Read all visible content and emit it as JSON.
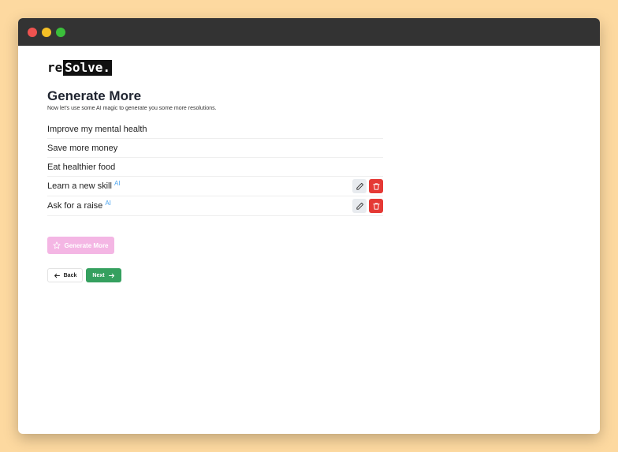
{
  "window": {
    "controls": [
      "close",
      "minimize",
      "maximize"
    ]
  },
  "logo": {
    "prefix": "re",
    "main": "Solve."
  },
  "page": {
    "title": "Generate More",
    "subtitle": "Now let's use some AI magic to generate you some more resolutions."
  },
  "resolutions": [
    {
      "text": "Improve my mental health",
      "ai": false
    },
    {
      "text": "Save more money",
      "ai": false
    },
    {
      "text": "Eat healthier food",
      "ai": false
    },
    {
      "text": "Learn a new skill",
      "ai": true,
      "ai_label": "AI"
    },
    {
      "text": "Ask for a raise",
      "ai": true,
      "ai_label": "AI"
    }
  ],
  "actions": {
    "generate_label": "Generate More"
  },
  "nav": {
    "back_label": "Back",
    "next_label": "Next"
  },
  "colors": {
    "background": "#fdd9a0",
    "titlebar": "#333333",
    "delete": "#e53935",
    "edit": "#e8ebef",
    "generate": "#f4b6e4",
    "next": "#35a05f",
    "ai_tag": "#4aa3ef"
  },
  "icons": {
    "edit": "pencil-icon",
    "delete": "trash-icon",
    "generate": "star-icon",
    "back": "arrow-left-icon",
    "next": "arrow-right-icon"
  }
}
